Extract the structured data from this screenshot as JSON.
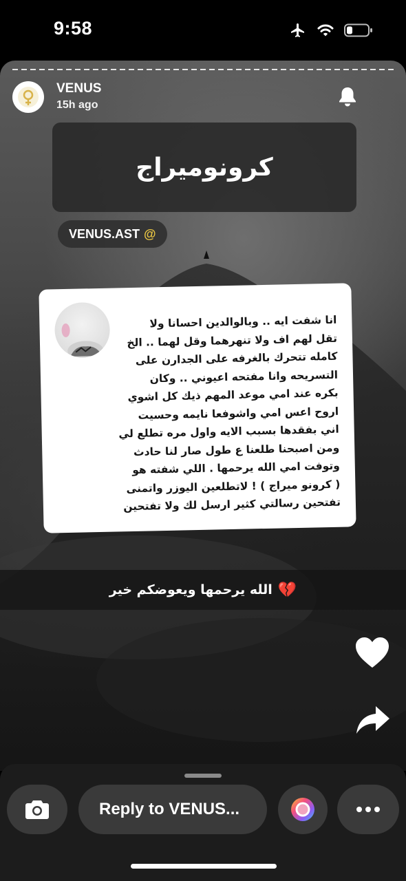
{
  "status_bar": {
    "time": "9:58",
    "icons": [
      "airplane-icon",
      "wifi-icon",
      "battery-icon"
    ]
  },
  "story": {
    "username": "VENUS",
    "time_ago": "15h ago",
    "title": "كرونوميراج",
    "mention": {
      "username": "VENUS.AST",
      "at_symbol": "@",
      "accent_color": "#e9c543"
    },
    "quote_text": "انا شفت ايه ..   وبالوالدين احسانا ولا\nتقل لهم اف ولا تنهرهما وقل لهما  .. الخ\nكامله  تتحرك بالغرفه على الجدارن  على\nالتسريحه   وانا مفتحه اعيوني   .. وكان\nبكره  عند امي موعد    المهم ذيك كل اشوي\nاروح اعس امي واشوفعا نايمه وحسيت\nاني بفقدها بسبب الايه واول مره تطلع لي\nومن اصبحنا  طلعنا ع طول صار لنا حادث\nوتوفت امي  الله يرحمها .   اللي شفته هو\n( كرونو ميراج ) !  لاتطلعين اليوزر  واتمنى\nتفتحين رسالتي كثير ارسل لك ولا تفتحين",
    "caption": "الله يرحمها  ويعوضكم خير",
    "caption_emoji": "💔"
  },
  "bottom_bar": {
    "reply_placeholder": "Reply to VENUS..."
  }
}
